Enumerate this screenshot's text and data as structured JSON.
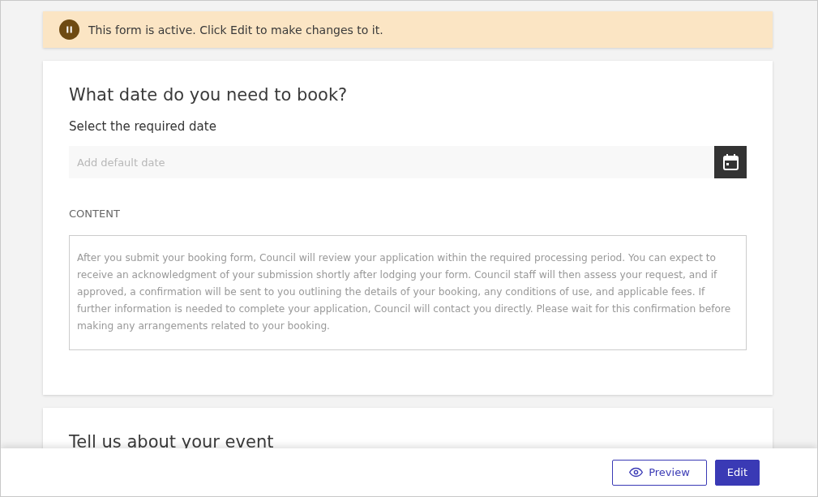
{
  "notice": {
    "text": "This form is active. Click Edit to make changes to it."
  },
  "cards": [
    {
      "title": "What date do you need to book?",
      "field_label": "Select the required date",
      "date_field": {
        "placeholder": "Add default date"
      },
      "content_label": "CONTENT",
      "content": "After you submit your booking form, Council will review your application within the required processing period. You can expect to receive an acknowledgment of your submission shortly after lodging your form. Council staff will then assess your request, and if approved, a confirmation will be sent to you outlining the details of your booking, any conditions of use, and applicable fees. If further information is needed to complete your application, Council will contact you directly. Please wait for this confirmation before making any arrangements related to your booking."
    },
    {
      "title": "Tell us about your event"
    }
  ],
  "footer": {
    "buttons": [
      {
        "label": "Preview",
        "kind": "outline"
      },
      {
        "label": "Edit",
        "kind": "solid"
      }
    ]
  }
}
